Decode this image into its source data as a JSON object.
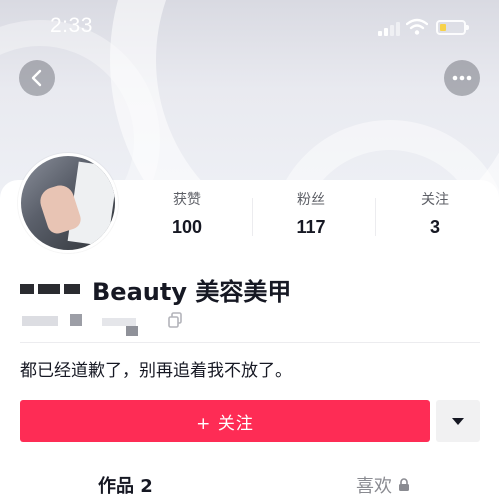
{
  "status_bar": {
    "time": "2:33",
    "icons": [
      "signal-icon",
      "wifi-icon",
      "battery-icon"
    ]
  },
  "nav": {
    "back_icon": "chevron-left-icon",
    "more_icon": "more-horizontal-icon"
  },
  "profile": {
    "display_name": "Beauty 美容美甲",
    "bio": "都已经道歉了，别再追着我不放了。",
    "stats": [
      {
        "label": "获赞",
        "value": "100"
      },
      {
        "label": "粉丝",
        "value": "117"
      },
      {
        "label": "关注",
        "value": "3"
      }
    ]
  },
  "actions": {
    "follow_label": "+ 关注",
    "dropdown_icon": "caret-down-icon"
  },
  "tabs": [
    {
      "label": "作品 2"
    },
    {
      "label": "喜欢"
    }
  ],
  "colors": {
    "accent": "#fe2c55",
    "text": "#161823",
    "muted": "#8a8b91"
  }
}
